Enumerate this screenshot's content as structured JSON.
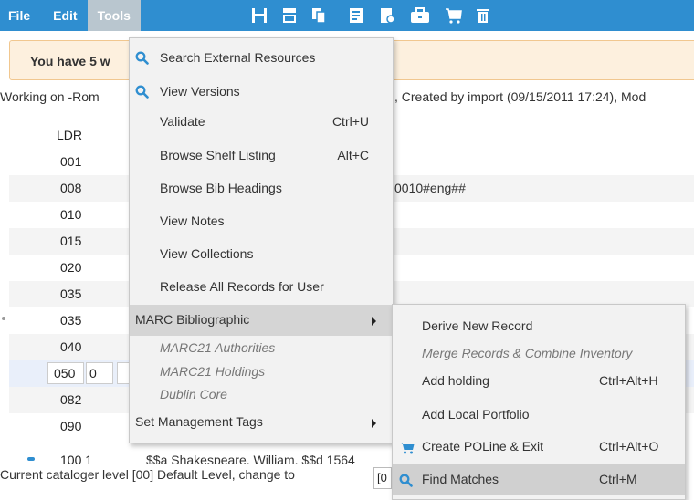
{
  "menubar": {
    "items": [
      {
        "label": "File"
      },
      {
        "label": "Edit"
      },
      {
        "label": "Tools"
      }
    ],
    "toolbar_icons": [
      "save-icon",
      "split-view-icon",
      "copy-icon",
      "template-icon",
      "add-record-icon",
      "suitcase-icon",
      "cart-icon",
      "trash-icon"
    ]
  },
  "notice": {
    "text": "You have 5 w"
  },
  "working": {
    "left": "Working on -Rom",
    "right": ", Created by import (09/15/2011 17:24), Mod"
  },
  "rows": [
    {
      "tag": "LDR",
      "content": ""
    },
    {
      "tag": "001",
      "content": ""
    },
    {
      "tag": "008",
      "content": "0010#eng##"
    },
    {
      "tag": "010",
      "content": ""
    },
    {
      "tag": "015",
      "content": ""
    },
    {
      "tag": "020",
      "content": ""
    },
    {
      "tag": "035",
      "content": ""
    },
    {
      "tag": "035",
      "content": ""
    },
    {
      "tag": "040",
      "content": ""
    },
    {
      "tag": "050",
      "ind": "0",
      "content": ""
    },
    {
      "tag": "082",
      "content": ""
    },
    {
      "tag": "090",
      "content": ""
    }
  ],
  "row100": {
    "tag": "100 1",
    "content": "$$a Shakespeare, William, $$d 1564"
  },
  "status": {
    "text": "Current cataloger level [00] Default Level, change to",
    "input_value": "[0"
  },
  "tools_menu": {
    "search_external": "Search External Resources",
    "view_versions": "View Versions",
    "validate": "Validate",
    "validate_shortcut": "Ctrl+U",
    "browse_shelf": "Browse Shelf Listing",
    "browse_shelf_shortcut": "Alt+C",
    "browse_bib": "Browse Bib Headings",
    "view_notes": "View Notes",
    "view_collections": "View Collections",
    "release_all": "Release All Records for User",
    "marc_bib": "MARC Bibliographic",
    "marc_auth": "MARC21 Authorities",
    "marc_holdings": "MARC21 Holdings",
    "dublin_core": "Dublin Core",
    "set_mgmt": "Set Management Tags"
  },
  "marc_submenu": {
    "derive": "Derive New Record",
    "merge": "Merge Records & Combine Inventory",
    "add_holding": "Add holding",
    "add_holding_shortcut": "Ctrl+Alt+H",
    "add_portfolio": "Add Local Portfolio",
    "create_poline": "Create POLine & Exit",
    "create_poline_shortcut": "Ctrl+Alt+O",
    "find_matches": "Find Matches",
    "find_matches_shortcut": "Ctrl+M"
  },
  "colors": {
    "accent": "#2f8ed0",
    "notice_bg": "#fdf0de",
    "menu_bg": "#f2f2f2"
  }
}
